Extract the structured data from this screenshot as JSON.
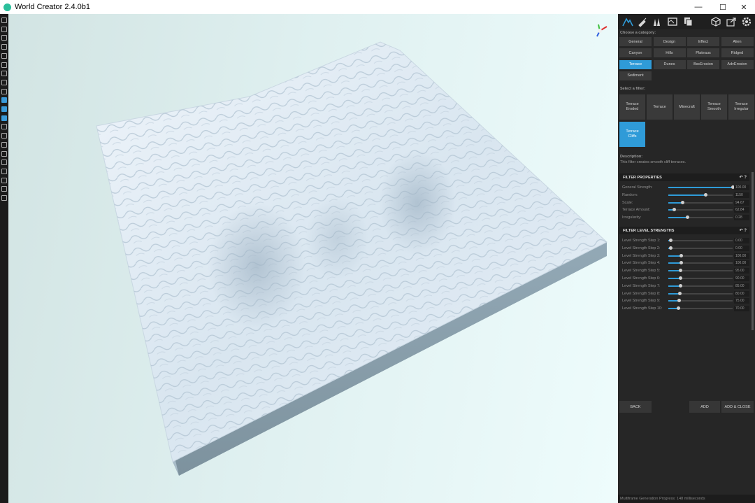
{
  "window": {
    "title": "World Creator 2.4.0b1",
    "minimize_glyph": "—",
    "maximize_glyph": "☐",
    "close_glyph": "✕"
  },
  "left_toolbar": {
    "icons": [
      "new-file-icon",
      "open-folder-icon",
      "save-icon",
      "save-as-icon",
      "export-icon",
      "settings-icon",
      "map-icon",
      "binoculars-icon",
      "globe-icon",
      "terrain-icon",
      "brush-icon",
      "layers-icon",
      "crown-icon",
      "path-icon",
      "camera-icon",
      "close-x-icon",
      "grid-icon",
      "image-icon",
      "sphere-icon",
      "gear-icon",
      "tool-icon"
    ],
    "active_indices": [
      9,
      10,
      11
    ]
  },
  "panel": {
    "tabs": [
      "terrain-tab-icon",
      "paint-tab-icon",
      "trees-tab-icon",
      "map-tab-icon",
      "layers-tab-icon",
      "cube-tab-icon",
      "share-tab-icon",
      "settings-tab-icon"
    ],
    "category_label": "Choose a category:",
    "categories": [
      "General",
      "Design",
      "Effect",
      "Alien",
      "Canyon",
      "Hills",
      "Plateaus",
      "Ridged",
      "Terrace",
      "Dunes",
      "BscErosion",
      "AdvErosion",
      "Sediment"
    ],
    "active_category": "Terrace",
    "filter_label": "Select a filter:",
    "filters": [
      "Terrace\nEroded",
      "Terrace",
      "Minecraft",
      "Terrace\nSmooth",
      "Terrace\nIrregular",
      "Terrace\nCliffs"
    ],
    "active_filter": "Terrace\nCliffs",
    "description_label": "Description:",
    "description_text": "This filter creates smooth cliff terraces.",
    "filter_properties": {
      "header": "FILTER PROPERTIES",
      "rows": [
        {
          "label": "General Strength:",
          "value": "100.00",
          "fraction": 1.0
        },
        {
          "label": "Random:",
          "value": "1150",
          "fraction": 0.58
        },
        {
          "label": "Scale:",
          "value": "94.67",
          "fraction": 0.22
        },
        {
          "label": "Terrace Amount:",
          "value": "62.84",
          "fraction": 0.09
        },
        {
          "label": "Irregularity:",
          "value": "0.28",
          "fraction": 0.29
        }
      ]
    },
    "filter_level_strengths": {
      "header": "FILTER LEVEL STRENGTHS",
      "rows": [
        {
          "label": "Level Strength Step 1:",
          "value": "0.00",
          "fraction": 0.03
        },
        {
          "label": "Level Strength Step 2:",
          "value": "0.00",
          "fraction": 0.03
        },
        {
          "label": "Level Strength Step 3:",
          "value": "100.00",
          "fraction": 0.2
        },
        {
          "label": "Level Strength Step 4:",
          "value": "100.00",
          "fraction": 0.2
        },
        {
          "label": "Level Strength Step 5:",
          "value": "95.00",
          "fraction": 0.19
        },
        {
          "label": "Level Strength Step 6:",
          "value": "90.00",
          "fraction": 0.18
        },
        {
          "label": "Level Strength Step 7:",
          "value": "85.00",
          "fraction": 0.18
        },
        {
          "label": "Level Strength Step 8:",
          "value": "80.00",
          "fraction": 0.17
        },
        {
          "label": "Level Strength Step 9:",
          "value": "75.00",
          "fraction": 0.16
        },
        {
          "label": "Level Strength Step 10:",
          "value": "70.00",
          "fraction": 0.15
        }
      ]
    },
    "header_icons": "↶  ?",
    "buttons": {
      "back": "BACK",
      "add": "ADD",
      "add_close": "ADD & CLOSE"
    },
    "status": "Multiframe Generation Progress: 148 milliseconds"
  },
  "colors": {
    "accent": "#2f9bd8",
    "panel_bg": "#262626",
    "terrain": "#dfeaf3"
  }
}
